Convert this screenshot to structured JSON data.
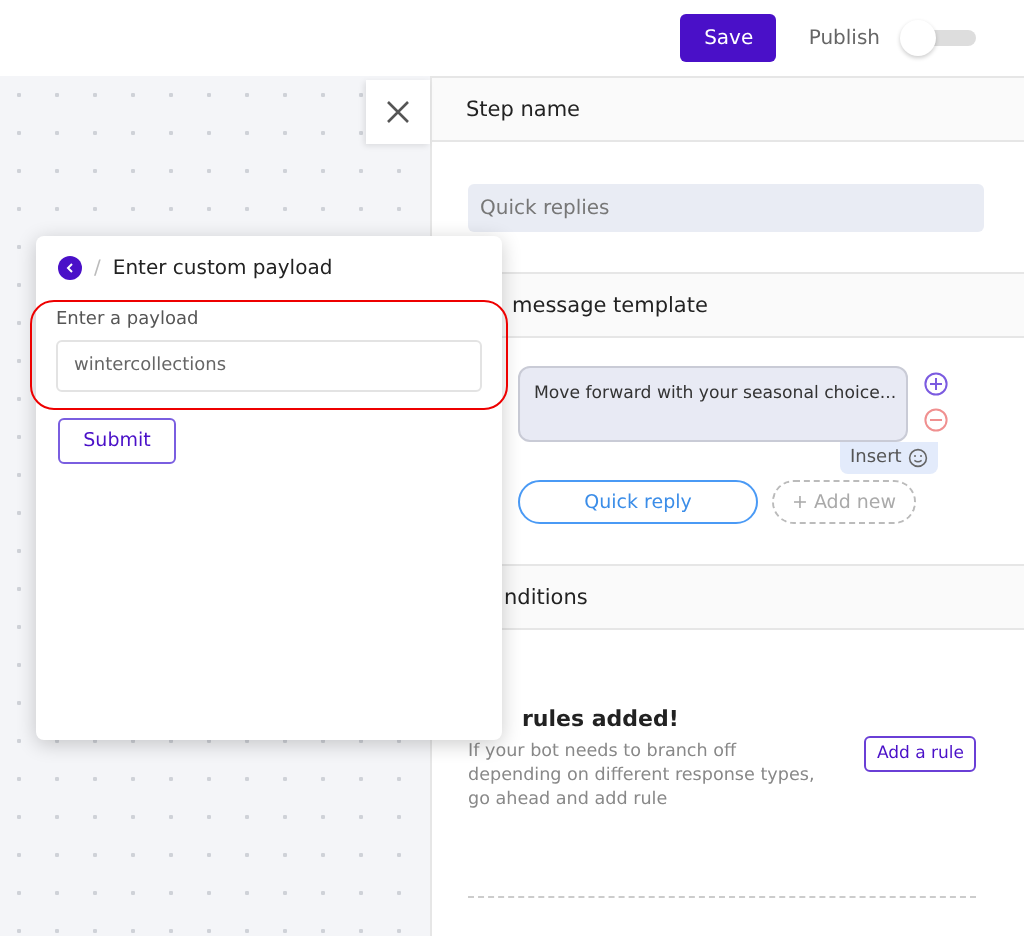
{
  "topbar": {
    "save": "Save",
    "publish": {
      "label": "Publish",
      "on": false
    }
  },
  "step": {
    "header": "Step name",
    "value": "Quick replies"
  },
  "template": {
    "header": "message template",
    "message": "Move forward with your seasonal choice...",
    "insert": "Insert",
    "chips": [
      {
        "label": "Quick reply",
        "kind": "reply"
      },
      {
        "label": "+ Add new",
        "kind": "add"
      }
    ]
  },
  "conditions": {
    "header": "nditions",
    "title": "rules added!",
    "text": "If your bot needs to branch off depending on different response types, go ahead and add rule",
    "button": "Add a rule"
  },
  "popup": {
    "separator": "/",
    "title": "Enter custom payload",
    "field_label": "Enter a payload",
    "value": "wintercollections",
    "submit": "Submit"
  }
}
